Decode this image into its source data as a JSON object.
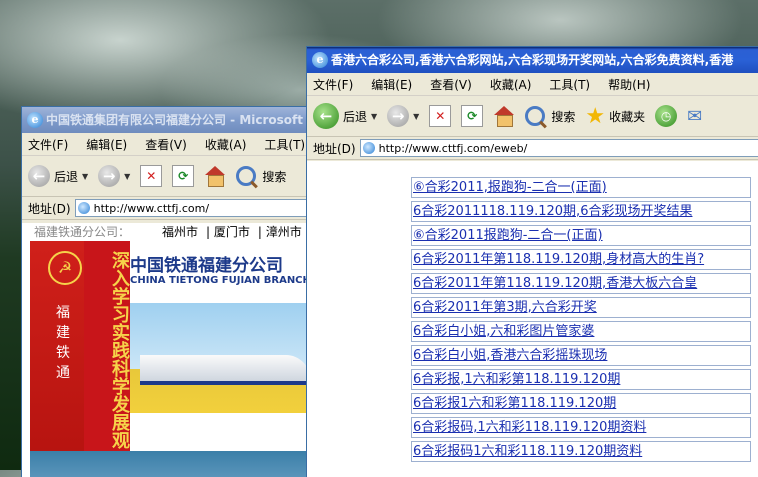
{
  "back_window": {
    "title": "中国铁通集团有限公司福建分公司 - Microsoft Internet Explorer",
    "menu": [
      "文件(F)",
      "编辑(E)",
      "查看(V)",
      "收藏(A)",
      "工具(T)"
    ],
    "toolbar": {
      "back_label": "后退",
      "search_label": "搜索"
    },
    "address": {
      "label": "地址(D)",
      "url": "http://www.cttfj.com/"
    },
    "city_nav": {
      "prefix": "福建铁通分公司：",
      "cities": [
        "福州市",
        "厦门市",
        "漳州市"
      ]
    },
    "banner": {
      "slogan": "深入学习实践科学发展观",
      "side_text": "福建铁通",
      "company_cn": "中国铁通福建分公司",
      "company_en": "CHINA TIETONG FUJIAN BRANCH"
    }
  },
  "front_window": {
    "title": "香港六合彩公司,香港六合彩网站,六合彩现场开奖网站,六合彩免费资料,香港",
    "menu": [
      "文件(F)",
      "编辑(E)",
      "查看(V)",
      "收藏(A)",
      "工具(T)",
      "帮助(H)"
    ],
    "toolbar": {
      "back_label": "后退",
      "search_label": "搜索",
      "favorites_label": "收藏夹"
    },
    "address": {
      "label": "地址(D)",
      "url": "http://www.cttfj.com/eweb/"
    },
    "links": [
      "⑥合彩2011,报跑狗-二合一(正面)",
      "6合彩2011118.119.120期,6合彩现场开奖结果",
      "⑥合彩2011报跑狗-二合一(正面)",
      "6合彩2011年第118.119.120期,身材高大的生肖?",
      "6合彩2011年第118.119.120期,香港大板六合皇",
      "6合彩2011年第3期,六合彩开奖",
      "6合彩白小姐,六和彩图片管家婆",
      "6合彩白小姐,香港六合彩摇珠现场",
      "6合彩报,1六和彩第118.119.120期",
      "6合彩报1六和彩第118.119.120期",
      "6合彩报码,1六和彩118.119.120期资料",
      "6合彩报码1六和彩118.119.120期资料"
    ]
  }
}
